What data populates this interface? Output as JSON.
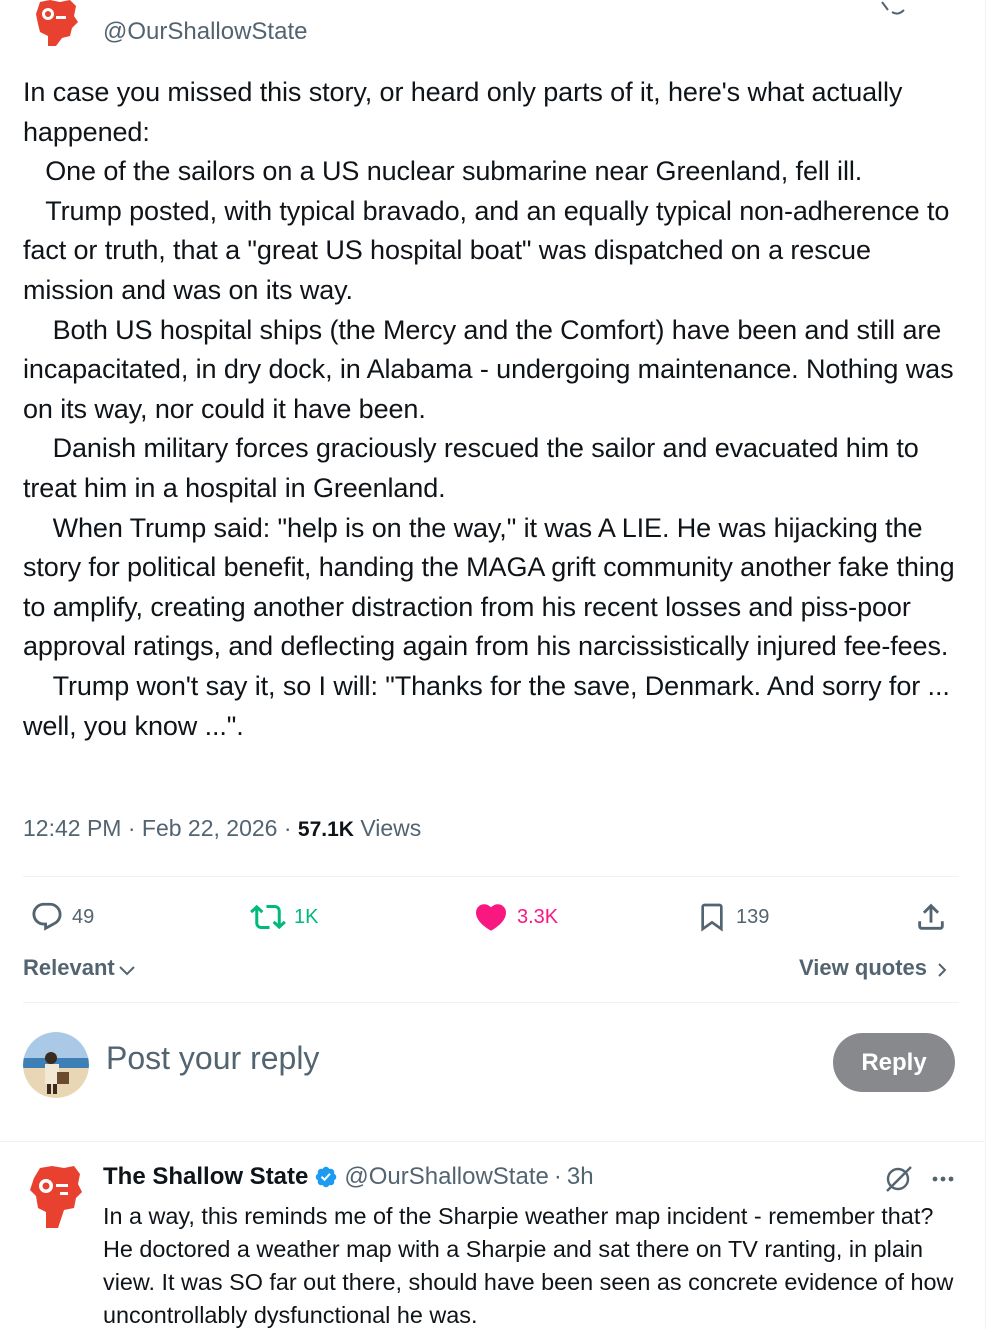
{
  "tweet": {
    "handle": "@OurShallowState",
    "paragraphs": [
      "In case you missed this story, or heard only parts of it, here's what actually happened:",
      "   One of the sailors on a US nuclear submarine near Greenland, fell ill.",
      "   Trump posted, with typical bravado, and an equally typical non-adherence to fact or truth, that a \"great US hospital boat\" was dispatched on a rescue mission and was on its way.",
      "    Both US hospital ships (the Mercy and the Comfort) have been and still are incapacitated, in dry dock, in Alabama - undergoing maintenance. Nothing was on its way, nor could it have been.",
      "    Danish military forces graciously rescued the sailor and evacuated him to treat him in a hospital in Greenland.",
      "    When Trump said: \"help is on the way,\" it was A LIE. He was hijacking the story for political benefit, handing the MAGA grift community another fake thing to amplify, creating another distraction from his recent losses and piss-poor approval ratings, and deflecting again from his narcissistically injured fee-fees.",
      "    Trump won't say it, so I will: \"Thanks for the save, Denmark. And sorry for ... well, you know ...\"."
    ],
    "time": "12:42 PM",
    "date": "Feb 22, 2026",
    "views_count": "57.1K",
    "views_label": "Views"
  },
  "actions": {
    "replies": "49",
    "reposts": "1K",
    "likes": "3.3K",
    "bookmarks": "139"
  },
  "sort": {
    "label": "Relevant",
    "view_quotes": "View quotes"
  },
  "compose": {
    "placeholder": "Post your reply",
    "button": "Reply"
  },
  "reply": {
    "name": "The Shallow State",
    "handle": "@OurShallowState",
    "separator": "·",
    "time": "3h",
    "text": "In a way, this reminds me of the Sharpie weather map incident - remember that? He doctored a weather map with a Sharpie and sat there on TV ranting, in plain view. It was SO far out there, should have been seen as concrete evidence of how uncontrollably dysfunctional he was."
  },
  "colors": {
    "text": "#0f1419",
    "secondary": "#536471",
    "repost": "#00ba7c",
    "like": "#f91880",
    "verified": "#1d9bf0",
    "reply_button": "#87898c"
  },
  "icons": [
    "reply-icon",
    "repost-icon",
    "heart-icon",
    "bookmark-icon",
    "share-icon",
    "chevron-down-icon",
    "chevron-right-icon",
    "verified-badge-icon",
    "grok-icon",
    "more-icon"
  ]
}
